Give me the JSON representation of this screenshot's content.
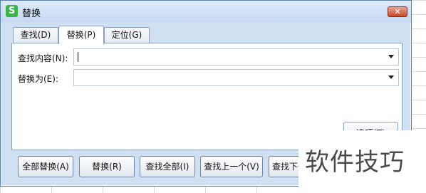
{
  "dialog": {
    "title": "替换",
    "app_icon_glyph": "S",
    "close_glyph": "✕"
  },
  "tabs": [
    {
      "label": "查找(D)",
      "active": false
    },
    {
      "label": "替换(P)",
      "active": true
    },
    {
      "label": "定位(G)",
      "active": false
    }
  ],
  "form": {
    "find_label": "查找内容(N):",
    "find_value": "",
    "replace_label": "替换为(E):",
    "replace_value": ""
  },
  "options_button": "选项(T)",
  "buttons": {
    "replace_all": "全部替换(A)",
    "replace": "替换(R)",
    "find_all": "查找全部(I)",
    "find_prev": "查找上一个(V)",
    "find_next": "查找下一个(F)"
  },
  "watermark": "软件技巧",
  "colors": {
    "dialog_bg": "#cfe0f3",
    "accent_icon": "#39b54a",
    "close_button": "#c7472a"
  }
}
